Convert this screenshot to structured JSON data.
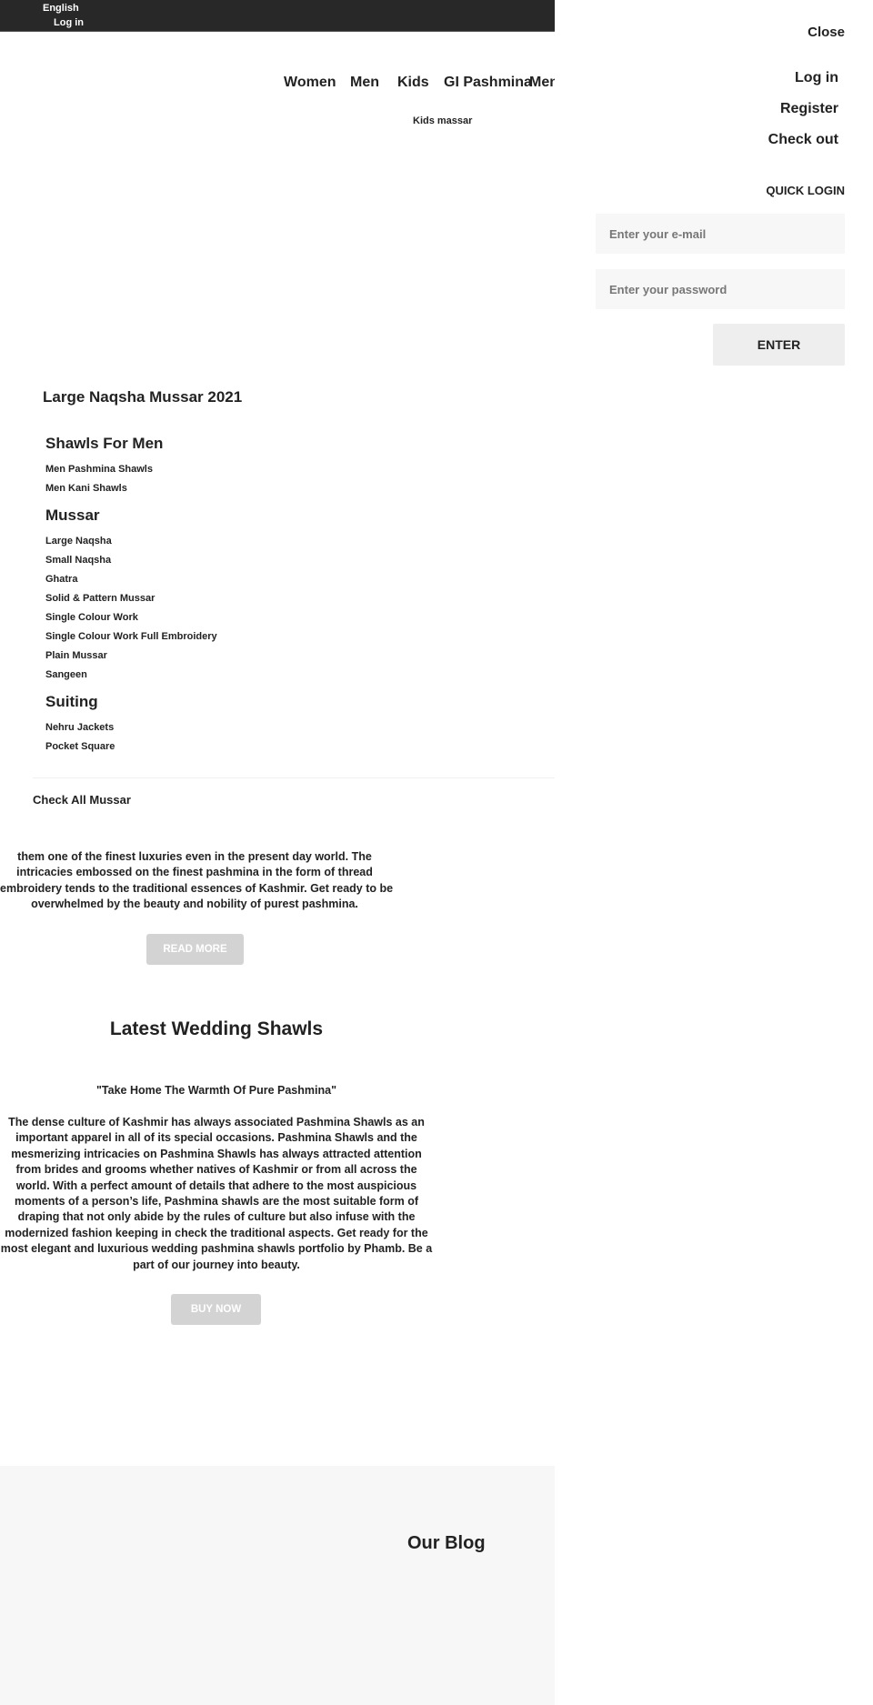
{
  "topbar": {
    "language": "English",
    "login": "Log in"
  },
  "nav": {
    "items": [
      "Women",
      "Men",
      "Kids",
      "GI Pashmina",
      "Men"
    ],
    "submenu": "Kids massar"
  },
  "side_panel": {
    "close": "Close",
    "login": "Log in",
    "register": "Register",
    "checkout": "Check out",
    "quick_login": "QUICK LOGIN",
    "email_placeholder": "Enter your e-mail",
    "password_placeholder": "Enter your password",
    "enter": "ENTER"
  },
  "mega_menu": {
    "title": "Large Naqsha Mussar 2021",
    "groups": [
      {
        "heading": "Shawls For Men",
        "items": [
          "Men Pashmina Shawls",
          "Men Kani Shawls"
        ]
      },
      {
        "heading": "Mussar",
        "items": [
          "Large Naqsha",
          "Small Naqsha",
          "Ghatra",
          "Solid & Pattern Mussar",
          "Single Colour Work",
          "Single Colour Work Full Embroidery",
          "Plain Mussar",
          "Sangeen"
        ]
      },
      {
        "heading": "Suiting",
        "items": [
          "Nehru Jackets",
          "Pocket Square"
        ]
      }
    ],
    "check_all": "Check All Mussar"
  },
  "intro": {
    "lines": [
      "them one of the finest luxuries even in the present day world. The",
      "intricacies embossed on the finest pashmina in the form of thread",
      "embroidery tends to the traditional essences of Kashmir. Get ready to be",
      "overwhelmed by the beauty and nobility of purest pashmina."
    ],
    "read_more": "READ MORE"
  },
  "wedding": {
    "title": "Latest Wedding Shawls",
    "quote": "\"Take Home The Warmth Of Pure Pashmina\"",
    "body": "The dense culture of Kashmir has always associated Pashmina Shawls as an important apparel in all of its special occasions. Pashmina Shawls and the mesmerizing intricacies on Pashmina Shawls has always attracted attention from brides and grooms whether natives of Kashmir or from all across the world. With a perfect amount of details that adhere to the most auspicious moments of a person’s life, Pashmina shawls are the most suitable form of draping that not only abide by the rules of culture but also infuse with the modernized fashion keeping in check the traditional aspects. Get ready for the most elegant and luxurious wedding pashmina shawls portfolio by Phamb. Be a part of our journey into beauty.",
    "buy_now": "BUY NOW"
  },
  "blog": {
    "title": "Our Blog"
  }
}
